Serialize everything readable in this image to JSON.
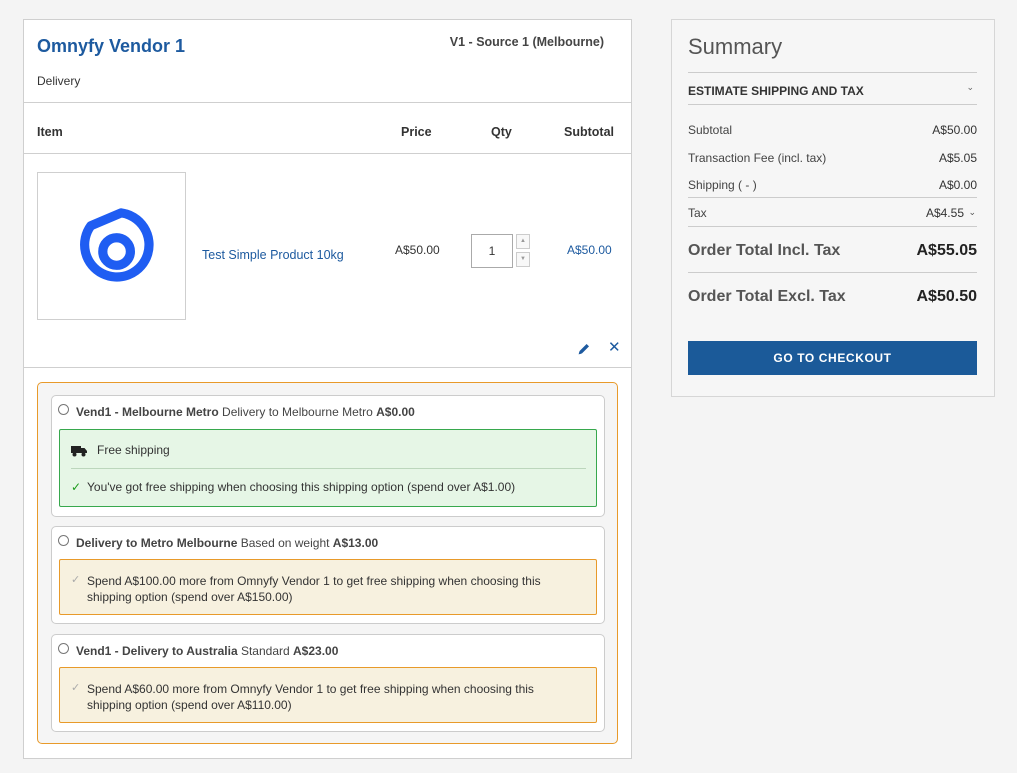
{
  "vendor": {
    "name": "Omnyfy Vendor 1",
    "source": "V1 - Source 1 (Melbourne)",
    "delivery_label": "Delivery"
  },
  "table": {
    "headers": {
      "item": "Item",
      "price": "Price",
      "qty": "Qty",
      "subtotal": "Subtotal"
    }
  },
  "item": {
    "name": "Test Simple Product 10kg",
    "price": "A$50.00",
    "qty": "1",
    "subtotal": "A$50.00",
    "thumbnail_icon": "omnyfy-logo-icon"
  },
  "shipping_options": [
    {
      "title_bold": "Vend1 - Melbourne Metro",
      "description": "Delivery to Melbourne Metro",
      "price": "A$0.00",
      "note_title": "Free shipping",
      "note_message": "You've got free shipping when choosing this shipping option (spend over A$1.00)"
    },
    {
      "title_bold": "Delivery to Metro Melbourne",
      "description": "Based on weight",
      "price": "A$13.00",
      "note_message": "Spend A$100.00 more from Omnyfy Vendor 1 to get free shipping when choosing this shipping option (spend over A$150.00)"
    },
    {
      "title_bold": "Vend1 - Delivery to Australia",
      "description": "Standard",
      "price": "A$23.00",
      "note_message": "Spend A$60.00 more from Omnyfy Vendor 1 to get free shipping when choosing this shipping option (spend over A$110.00)"
    }
  ],
  "summary": {
    "title": "Summary",
    "estimate_label": "ESTIMATE SHIPPING AND TAX",
    "subtotal_label": "Subtotal",
    "subtotal_value": "A$50.00",
    "fee_label": "Transaction Fee (incl. tax)",
    "fee_value": "A$5.05",
    "shipping_label": "Shipping ( - )",
    "shipping_value": "A$0.00",
    "tax_label": "Tax",
    "tax_value": "A$4.55",
    "total_incl_label": "Order Total Incl. Tax",
    "total_incl_value": "A$55.05",
    "total_excl_label": "Order Total Excl. Tax",
    "total_excl_value": "A$50.50",
    "checkout_label": "GO TO CHECKOUT"
  },
  "colors": {
    "brand_blue": "#1d5a9f",
    "checkout_blue": "#1b5a99",
    "logo_blue": "#1f5df2",
    "success_green": "#37a84d",
    "warning_orange": "#e89a2a"
  }
}
